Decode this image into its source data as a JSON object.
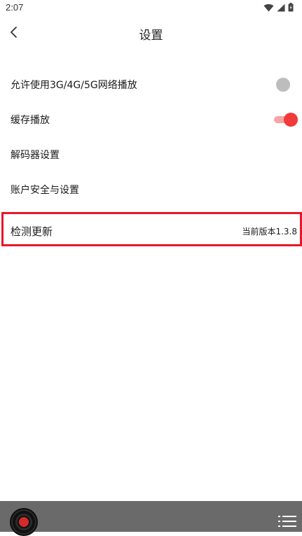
{
  "status_bar": {
    "time": "2:07",
    "icons": [
      "wifi-icon",
      "signal-icon",
      "battery-icon"
    ]
  },
  "header": {
    "title": "设置",
    "back_icon": "back-arrow-icon"
  },
  "settings": [
    {
      "label": "允许使用3G/4G/5G网络播放",
      "toggle": "off"
    },
    {
      "label": "缓存播放",
      "toggle": "on"
    },
    {
      "label": "解码器设置"
    },
    {
      "label": "账户安全与设置"
    }
  ],
  "update_row": {
    "label": "检测更新",
    "version": "当前版本1.3.8"
  },
  "player_bar": {
    "disc_icon": "vinyl-disc-icon",
    "playlist_icon": "playlist-icon"
  },
  "colors": {
    "accent": "#f23a3a",
    "highlight_border": "#e8172b",
    "player_bar": "#6a6a6a",
    "toggle_off": "#bdbdbd"
  }
}
